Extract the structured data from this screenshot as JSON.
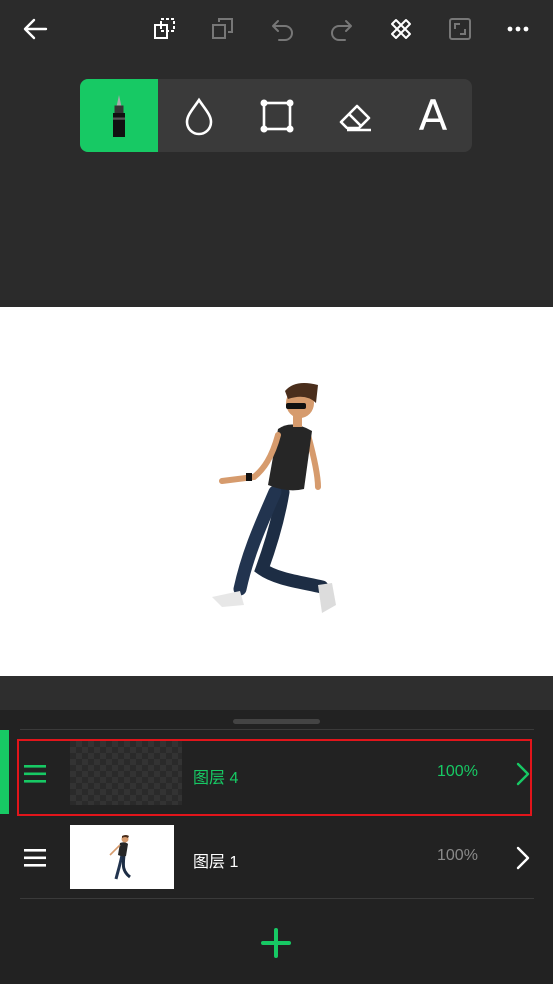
{
  "topbar": {
    "icons": [
      "back-arrow-icon",
      "duplicate-icon",
      "copy-icon",
      "undo-icon",
      "redo-icon",
      "tools-icon",
      "fullscreen-icon",
      "more-icon"
    ]
  },
  "toolbox": {
    "tools": [
      {
        "name": "pen",
        "icon": "pen-icon",
        "active": true
      },
      {
        "name": "fill",
        "icon": "drop-icon",
        "active": false
      },
      {
        "name": "transform",
        "icon": "transform-icon",
        "active": false
      },
      {
        "name": "eraser",
        "icon": "eraser-icon",
        "active": false
      },
      {
        "name": "text",
        "label": "A",
        "active": false
      }
    ]
  },
  "layers": [
    {
      "name": "图层 4",
      "opacity": "100%",
      "selected": true,
      "thumbnail": "transparent"
    },
    {
      "name": "图层 1",
      "opacity": "100%",
      "selected": false,
      "thumbnail": "walking-man"
    }
  ],
  "colors": {
    "accent": "#17c964",
    "background": "#2b2b2b",
    "panel": "#222222",
    "highlight": "#e2151b",
    "muted": "#8a8a8a"
  }
}
